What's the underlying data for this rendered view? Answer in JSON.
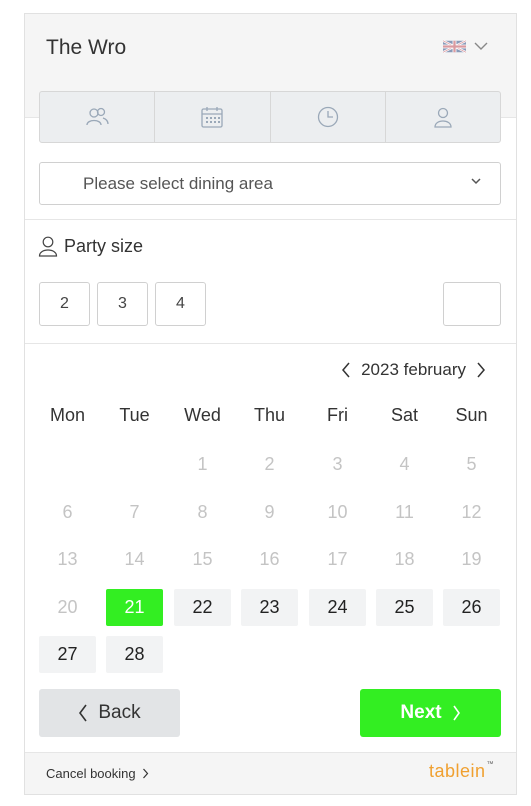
{
  "header": {
    "title": "The Wro",
    "language": "English (UK flag)"
  },
  "steps": [
    {
      "icon": "people-icon"
    },
    {
      "icon": "calendar-icon"
    },
    {
      "icon": "clock-icon"
    },
    {
      "icon": "user-icon"
    }
  ],
  "dining_area": {
    "placeholder": "Please select dining area"
  },
  "party": {
    "label": "Party size",
    "options": [
      "2",
      "3",
      "4"
    ],
    "custom_value": ""
  },
  "calendar": {
    "month_label": "2023 february",
    "weekdays": [
      "Mon",
      "Tue",
      "Wed",
      "Thu",
      "Fri",
      "Sat",
      "Sun"
    ],
    "weeks": [
      [
        "",
        "",
        "1",
        "2",
        "3",
        "4",
        "5"
      ],
      [
        "6",
        "7",
        "8",
        "9",
        "10",
        "11",
        "12"
      ],
      [
        "13",
        "14",
        "15",
        "16",
        "17",
        "18",
        "19"
      ],
      [
        "20",
        "21",
        "22",
        "23",
        "24",
        "25",
        "26"
      ],
      [
        "27",
        "28",
        "",
        "",
        "",
        "",
        ""
      ]
    ],
    "selected_day": "21",
    "available_days": [
      "21",
      "22",
      "23",
      "24",
      "25",
      "26",
      "27",
      "28"
    ]
  },
  "actions": {
    "back_label": "Back",
    "next_label": "Next"
  },
  "footer": {
    "cancel_label": "Cancel booking",
    "brand": "tablein",
    "brand_mark": "™"
  },
  "colors": {
    "accent": "#33ee22",
    "brand": "#f0a030"
  }
}
